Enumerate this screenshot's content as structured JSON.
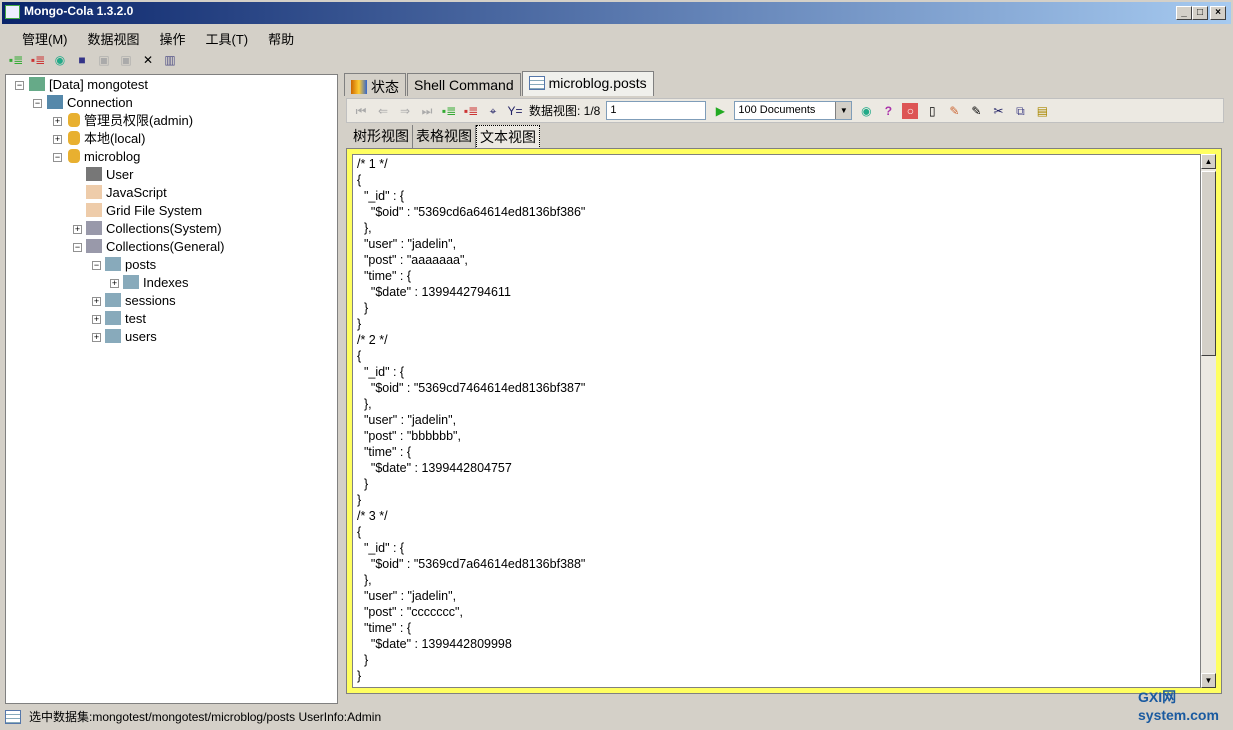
{
  "window": {
    "title": "Mongo-Cola  1.3.2.0",
    "min": "_",
    "max": "□",
    "close": "×"
  },
  "menu": [
    "管理(M)",
    "数据视图",
    "操作",
    "工具(T)",
    "帮助"
  ],
  "toolbar_icons": [
    "add-icon",
    "remove-icon",
    "refresh-icon",
    "window-icon",
    "disabled-icon",
    "stop-icon",
    "tools-icon",
    "book-icon"
  ],
  "tree": [
    {
      "label": "[Data]  mongotest",
      "icon": "server-icon",
      "exp": "−"
    },
    {
      "label": "Connection",
      "icon": "connection-icon",
      "exp": "−"
    },
    {
      "label": "管理员权限(admin)",
      "icon": "database-icon",
      "exp": "+"
    },
    {
      "label": "本地(local)",
      "icon": "database-icon",
      "exp": "+"
    },
    {
      "label": "microblog",
      "icon": "database-icon",
      "exp": "−"
    },
    {
      "label": "User",
      "icon": "user-icon",
      "exp": ""
    },
    {
      "label": "JavaScript",
      "icon": "folder-icon",
      "exp": ""
    },
    {
      "label": "Grid File System",
      "icon": "folder-open-icon",
      "exp": ""
    },
    {
      "label": "Collections(System)",
      "icon": "collections-icon",
      "exp": "+"
    },
    {
      "label": "Collections(General)",
      "icon": "collections-icon",
      "exp": "−"
    },
    {
      "label": "posts",
      "icon": "table-icon",
      "exp": "−"
    },
    {
      "label": "Indexes",
      "icon": "index-icon",
      "exp": "+"
    },
    {
      "label": "sessions",
      "icon": "table-icon",
      "exp": "+"
    },
    {
      "label": "test",
      "icon": "table-icon",
      "exp": "+"
    },
    {
      "label": "users",
      "icon": "table-icon",
      "exp": "+"
    }
  ],
  "tabs": [
    {
      "label": "状态",
      "icon": "chart-icon"
    },
    {
      "label": "Shell Command"
    },
    {
      "label": "microblog.posts",
      "icon": "table-icon",
      "active": true
    }
  ],
  "datatoolbar": {
    "page_label": "数据视图: 1/8",
    "page_value": "1",
    "docs": "100 Documents"
  },
  "subtabs": [
    "树形视图",
    "表格视图",
    "文本视图"
  ],
  "text_lines": [
    "/* 1 */",
    "{",
    "  \"_id\" : {",
    "    \"$oid\" : \"5369cd6a64614ed8136bf386\"",
    "  },",
    "  \"user\" : \"jadelin\",",
    "  \"post\" : \"aaaaaaa\",",
    "  \"time\" : {",
    "    \"$date\" : 1399442794611",
    "  }",
    "}",
    "/* 2 */",
    "{",
    "  \"_id\" : {",
    "    \"$oid\" : \"5369cd7464614ed8136bf387\"",
    "  },",
    "  \"user\" : \"jadelin\",",
    "  \"post\" : \"bbbbbb\",",
    "  \"time\" : {",
    "    \"$date\" : 1399442804757",
    "  }",
    "}",
    "/* 3 */",
    "{",
    "  \"_id\" : {",
    "    \"$oid\" : \"5369cd7a64614ed8136bf388\"",
    "  },",
    "  \"user\" : \"jadelin\",",
    "  \"post\" : \"ccccccc\",",
    "  \"time\" : {",
    "    \"$date\" : 1399442809998",
    "  }",
    "}"
  ],
  "status": "选中数据集:mongotest/mongotest/microblog/posts  UserInfo:Admin",
  "watermark": "GXI网 system.com",
  "colors": {
    "editor_border": "#ffff60",
    "titlebar": "#0a246a"
  }
}
